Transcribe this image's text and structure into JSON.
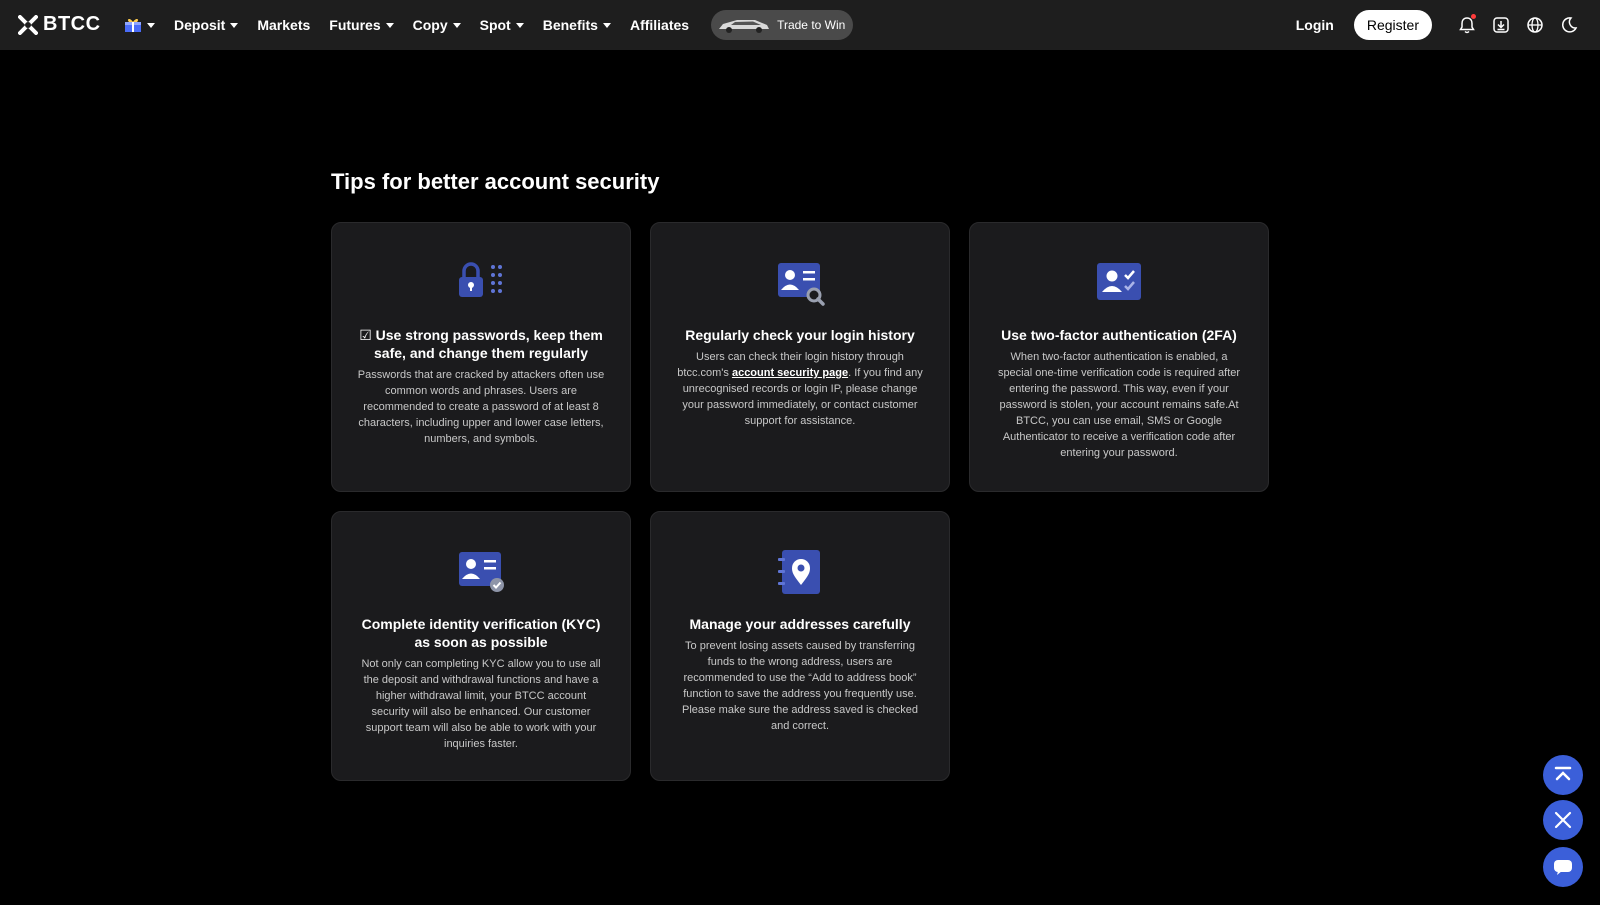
{
  "brand": {
    "name": "BTCC"
  },
  "nav": {
    "items": [
      {
        "label": "Deposit",
        "dropdown": true
      },
      {
        "label": "Markets",
        "dropdown": false
      },
      {
        "label": "Futures",
        "dropdown": true
      },
      {
        "label": "Copy",
        "dropdown": true
      },
      {
        "label": "Spot",
        "dropdown": true
      },
      {
        "label": "Benefits",
        "dropdown": true
      },
      {
        "label": "Affiliates",
        "dropdown": false
      }
    ],
    "promo_label": "Trade to Win",
    "login_label": "Login",
    "register_label": "Register",
    "icons": [
      "gift-icon",
      "bell-icon",
      "download-icon",
      "globe-icon",
      "moon-icon"
    ]
  },
  "page": {
    "heading": "Tips for better account security",
    "cards": [
      {
        "icon": "lock-icon",
        "title": "☑ Use strong passwords, keep them safe, and change them regularly",
        "desc": "Passwords that are cracked by attackers often use common words and phrases. Users are recommended to create a password of at least 8 characters, including upper and lower case letters, numbers, and symbols."
      },
      {
        "icon": "id-search-icon",
        "title": "Regularly check your login history",
        "desc_before": "Users can check their login history through btcc.com's ",
        "desc_link": "account security page",
        "desc_after": ". If you find any unrecognised records or login IP, please change your password immediately, or contact customer support for assistance."
      },
      {
        "icon": "user-check-icon",
        "title": "Use two-factor authentication (2FA)",
        "desc": "When two-factor authentication is enabled, a special one-time verification code is required after entering the password. This way, even if your password is stolen, your account remains safe.At BTCC, you can use email, SMS or Google Authenticator to receive a verification code after entering your password."
      },
      {
        "icon": "id-verified-icon",
        "title": "Complete identity verification (KYC) as soon as possible",
        "desc": "Not only can completing KYC allow you to use all the deposit and withdrawal functions and have a higher withdrawal limit, your BTCC account security will also be enhanced. Our customer support team will also be able to work with your inquiries faster."
      },
      {
        "icon": "address-book-icon",
        "title": "Manage your addresses carefully",
        "desc": "To prevent losing assets caused by transferring funds to the wrong address, users are recommended to use the “Add to address book” function to save the address you frequently use. Please make sure the address saved is checked and correct."
      }
    ]
  },
  "floating": [
    "back-to-top-icon",
    "x-social-icon",
    "chat-icon"
  ],
  "colors": {
    "accent": "#3b5fd9",
    "icon_blue": "#3a4fb0",
    "card_bg": "#1b1b1d",
    "nav_bg": "#1e1e1e"
  }
}
